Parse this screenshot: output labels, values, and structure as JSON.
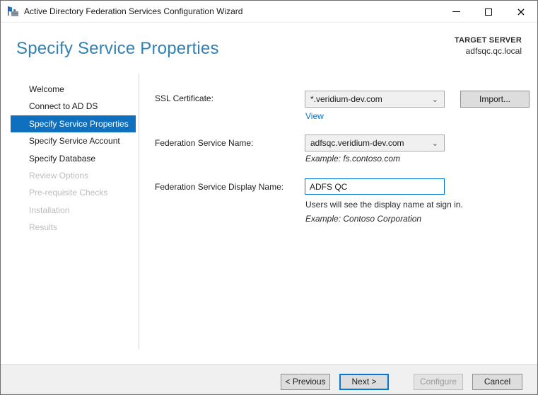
{
  "window": {
    "title": "Active Directory Federation Services Configuration Wizard",
    "close_glyph": "×"
  },
  "header": {
    "title": "Specify Service Properties",
    "target_server_label": "TARGET SERVER",
    "target_server_value": "adfsqc.qc.local"
  },
  "sidebar": {
    "items": [
      {
        "label": "Welcome",
        "state": "enabled"
      },
      {
        "label": "Connect to AD DS",
        "state": "enabled"
      },
      {
        "label": "Specify Service Properties",
        "state": "selected"
      },
      {
        "label": "Specify Service Account",
        "state": "enabled"
      },
      {
        "label": "Specify Database",
        "state": "enabled"
      },
      {
        "label": "Review Options",
        "state": "disabled"
      },
      {
        "label": "Pre-requisite Checks",
        "state": "disabled"
      },
      {
        "label": "Installation",
        "state": "disabled"
      },
      {
        "label": "Results",
        "state": "disabled"
      }
    ]
  },
  "form": {
    "ssl_certificate": {
      "label": "SSL Certificate:",
      "value": "*.veridium-dev.com",
      "import_button": "Import...",
      "view_link": "View"
    },
    "federation_service_name": {
      "label": "Federation Service Name:",
      "value": "adfsqc.veridium-dev.com",
      "example": "Example: fs.contoso.com"
    },
    "federation_service_display_name": {
      "label": "Federation Service Display Name:",
      "value": "ADFS QC",
      "hint": "Users will see the display name at sign in.",
      "example": "Example: Contoso Corporation"
    }
  },
  "footer": {
    "previous_button": "< Previous",
    "next_button": "Next >",
    "configure_button": "Configure",
    "cancel_button": "Cancel"
  },
  "icons": {
    "chevron_down": "⌄"
  },
  "colors": {
    "accent_blue": "#0e70bf",
    "heading_blue": "#3380b2",
    "link_blue": "#0b6fc4",
    "focus_border": "#0078d7"
  }
}
